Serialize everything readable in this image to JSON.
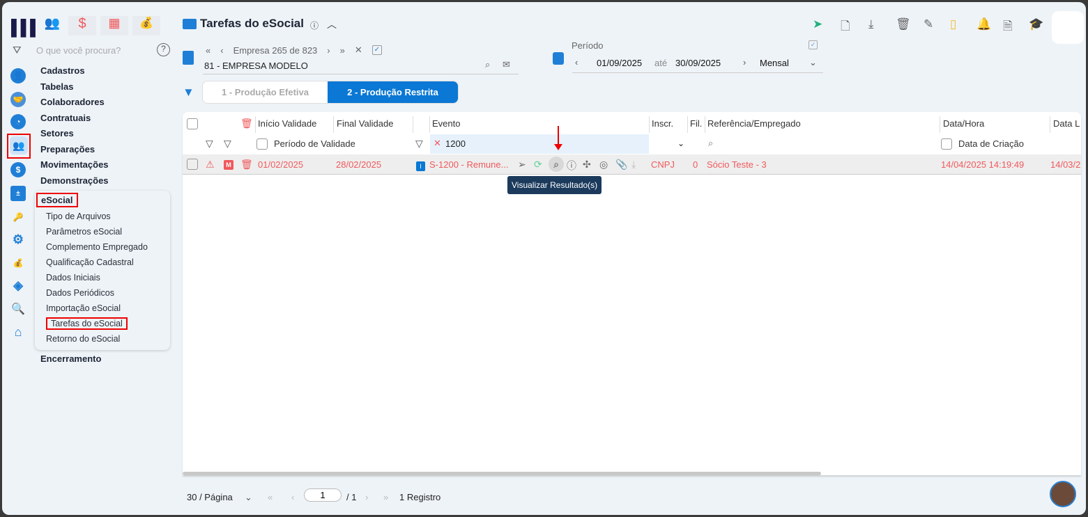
{
  "top_modules": [
    {
      "icon": "people-icon"
    },
    {
      "icon": "dollar-icon"
    },
    {
      "icon": "calculator-icon"
    },
    {
      "icon": "money-bag-icon"
    }
  ],
  "search": {
    "placeholder": "O que você procura?"
  },
  "menu": {
    "items": [
      "Cadastros",
      "Tabelas",
      "Colaboradores",
      "Contratuais",
      "Setores",
      "Preparações",
      "Movimentações",
      "Demonstrações"
    ],
    "esocial": {
      "label": "eSocial",
      "items": [
        "Tipo de Arquivos",
        "Parâmetros eSocial",
        "Complemento Empregado",
        "Qualificação Cadastral",
        "Dados Iniciais",
        "Dados Periódicos",
        "Importação eSocial",
        "Tarefas do eSocial",
        "Retorno do eSocial"
      ],
      "selected": "Tarefas do eSocial"
    },
    "after": "Encerramento"
  },
  "header": {
    "title": "Tarefas do eSocial",
    "info": "ⓘ"
  },
  "empresa": {
    "nav": "Empresa 265 de 823",
    "name": "81 - EMPRESA MODELO"
  },
  "periodo": {
    "label": "Período",
    "from": "01/09/2025",
    "sep": "até",
    "to": "30/09/2025",
    "mode": "Mensal"
  },
  "tabs": [
    {
      "label": "1 - Produção Efetiva",
      "active": false
    },
    {
      "label": "2 - Produção Restrita",
      "active": true
    }
  ],
  "table": {
    "headers": [
      "Início Validade",
      "Final Validade",
      "Evento",
      "Inscr.",
      "Fil.",
      "Referência/Empregado",
      "Data/Hora",
      "Data L"
    ],
    "filters": {
      "validade": "Período de Validade",
      "evento": "1200",
      "data": "Data de Criação"
    },
    "row": {
      "flag": "M",
      "tipo": "I",
      "inicio": "01/02/2025",
      "final": "28/02/2025",
      "evento": "S-1200 - Remune...",
      "inscr": "CNPJ",
      "fil": "0",
      "ref": "Sócio Teste - 3",
      "datahora": "14/04/2025 14:19:49",
      "datal": "14/03/2"
    },
    "tooltip": "Visualizar Resultado(s)"
  },
  "pagination": {
    "per_page": "30 / Página",
    "page": "1",
    "total": "/ 1",
    "records": "1 Registro"
  },
  "colors": {
    "accent": "#0a78d4",
    "error": "#f0595c",
    "tooltip": "#1b3a5c"
  }
}
